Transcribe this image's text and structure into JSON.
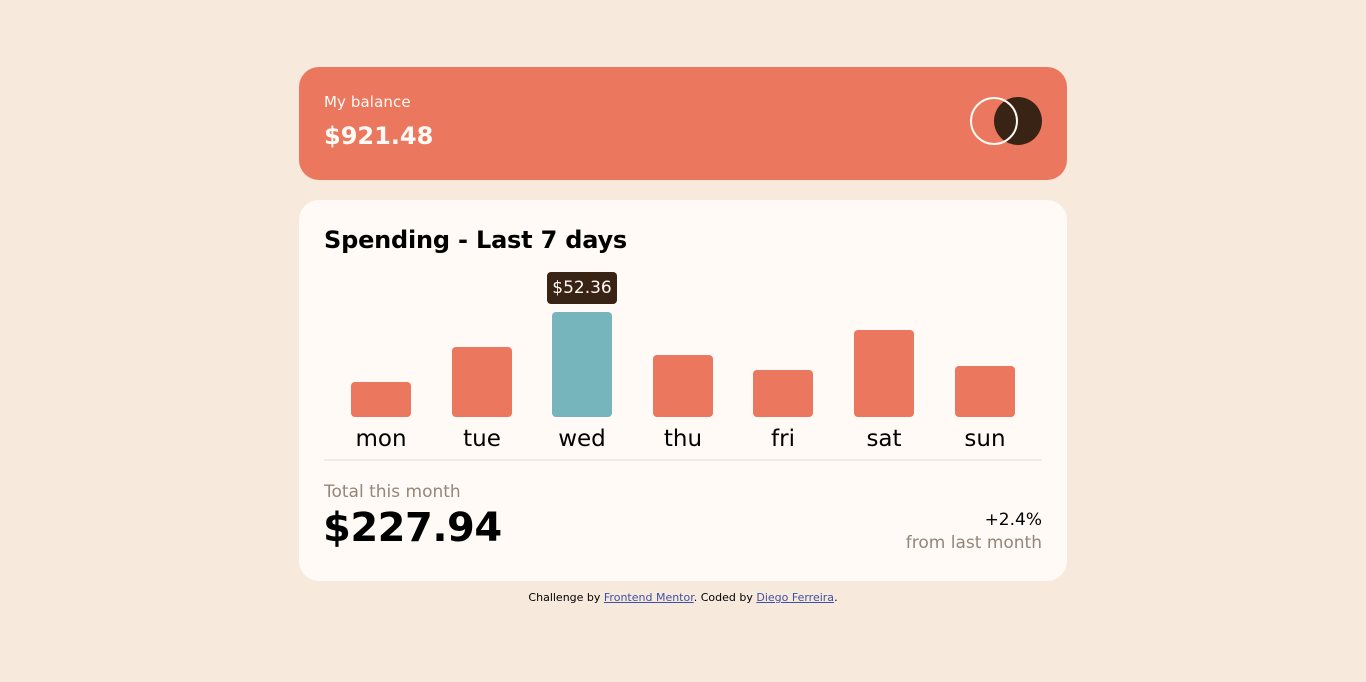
{
  "balance": {
    "label": "My balance",
    "amount": "$921.48"
  },
  "spending": {
    "title": "Spending - Last 7 days",
    "tooltip": "$52.36",
    "active_index": 2,
    "max_value": 52.36
  },
  "chart_data": {
    "type": "bar",
    "categories": [
      "mon",
      "tue",
      "wed",
      "thu",
      "fri",
      "sat",
      "sun"
    ],
    "values": [
      17.45,
      34.91,
      52.36,
      31.07,
      23.39,
      43.28,
      25.48
    ],
    "title": "Spending - Last 7 days",
    "xlabel": "",
    "ylabel": "",
    "grid": false
  },
  "summary": {
    "total_label": "Total this month",
    "total_amount": "$227.94",
    "change_pct": "+2.4%",
    "change_label": "from last month"
  },
  "footer": {
    "prefix": "Challenge by ",
    "link1": "Frontend Mentor",
    "middle": ". Coded by ",
    "link2": "Diego Ferreira",
    "suffix": "."
  },
  "colors": {
    "background": "#f8e9dd",
    "accent": "#ec775f",
    "active_bar": "#76b5bc",
    "dark": "#382314",
    "card": "#fffaf5",
    "muted": "#93867b"
  },
  "icons": {
    "logo": "two-circles-logo-icon"
  }
}
